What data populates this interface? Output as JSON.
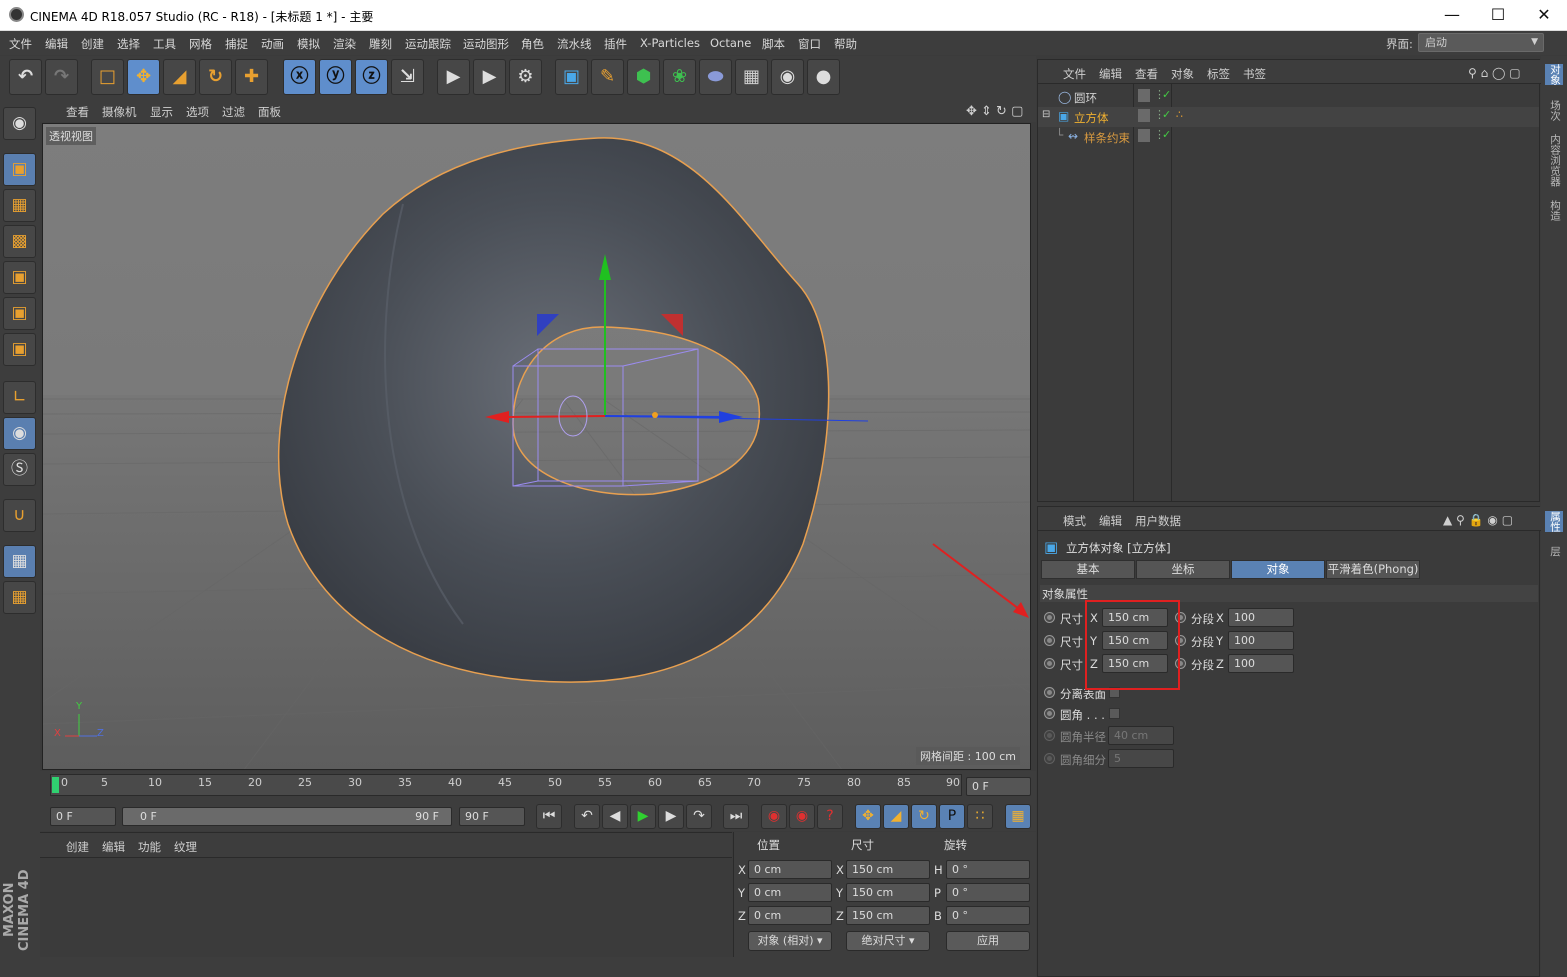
{
  "window": {
    "title": "CINEMA 4D R18.057 Studio (RC - R18) - [未标题 1 *] - 主要"
  },
  "menu": [
    "文件",
    "编辑",
    "创建",
    "选择",
    "工具",
    "网格",
    "捕捉",
    "动画",
    "模拟",
    "渲染",
    "雕刻",
    "运动跟踪",
    "运动图形",
    "角色",
    "流水线",
    "插件",
    "X-Particles",
    "Octane",
    "脚本",
    "窗口",
    "帮助"
  ],
  "layout": {
    "label": "界面:",
    "value": "启动"
  },
  "viewport": {
    "menu": [
      "查看",
      "摄像机",
      "显示",
      "选项",
      "过滤",
      "面板"
    ],
    "name": "透视视图",
    "grid_spacing": "网格间距 : 100 cm",
    "axis_y": "Y",
    "axis_x": "X",
    "axis_z": "Z"
  },
  "timeline": {
    "ticks": [
      "0",
      "5",
      "10",
      "15",
      "20",
      "25",
      "30",
      "35",
      "40",
      "45",
      "50",
      "55",
      "60",
      "65",
      "70",
      "75",
      "80",
      "85",
      "90"
    ],
    "current_frame": "0 F"
  },
  "playback": {
    "start": "0 F",
    "range_start": "0 F",
    "range_end": "90 F",
    "end": "90 F"
  },
  "material_manager": {
    "menu": [
      "创建",
      "编辑",
      "功能",
      "纹理"
    ]
  },
  "coordinates": {
    "headers": [
      "位置",
      "尺寸",
      "旋转"
    ],
    "rows": [
      {
        "axis": "X",
        "pos": "0 cm",
        "size_axis": "X",
        "size": "150 cm",
        "rot_axis": "H",
        "rot": "0 °"
      },
      {
        "axis": "Y",
        "pos": "0 cm",
        "size_axis": "Y",
        "size": "150 cm",
        "rot_axis": "P",
        "rot": "0 °"
      },
      {
        "axis": "Z",
        "pos": "0 cm",
        "size_axis": "Z",
        "size": "150 cm",
        "rot_axis": "B",
        "rot": "0 °"
      }
    ],
    "mode": "对象 (相对)",
    "size_mode": "绝对尺寸",
    "apply": "应用"
  },
  "object_manager": {
    "menu": [
      "文件",
      "编辑",
      "查看",
      "对象",
      "标签",
      "书签"
    ],
    "objects": [
      {
        "name": "圆环",
        "color": "#cfcfcf"
      },
      {
        "name": "立方体",
        "color": "#f0b030"
      },
      {
        "name": "样条约束",
        "color": "#d89a40"
      }
    ]
  },
  "attribute_manager": {
    "menu": [
      "模式",
      "编辑",
      "用户数据"
    ],
    "title": "立方体对象 [立方体]",
    "tabs": [
      "基本",
      "坐标",
      "对象",
      "平滑着色(Phong)"
    ],
    "active_tab": "对象",
    "section": "对象属性",
    "size_label": "尺寸",
    "seg_label": "分段",
    "size_rows": [
      {
        "axis": "X",
        "size": "150 cm",
        "seg_axis": "X",
        "seg": "100"
      },
      {
        "axis": "Y",
        "size": "150 cm",
        "seg_axis": "Y",
        "seg": "100"
      },
      {
        "axis": "Z",
        "size": "150 cm",
        "seg_axis": "Z",
        "seg": "100"
      }
    ],
    "separate_surfaces": "分离表面",
    "fillet": "圆角 . . . .",
    "fillet_radius_label": "圆角半径",
    "fillet_radius": "40 cm",
    "fillet_subdiv_label": "圆角细分",
    "fillet_subdiv": "5"
  },
  "right_tabs": [
    "对象",
    "场次",
    "内容浏览器",
    "构造",
    "属性",
    "层"
  ],
  "brand": "MAXON CINEMA 4D",
  "colors": {
    "accent": "#5a82b4",
    "highlight": "#e02020",
    "object_orange": "#f0b030"
  }
}
